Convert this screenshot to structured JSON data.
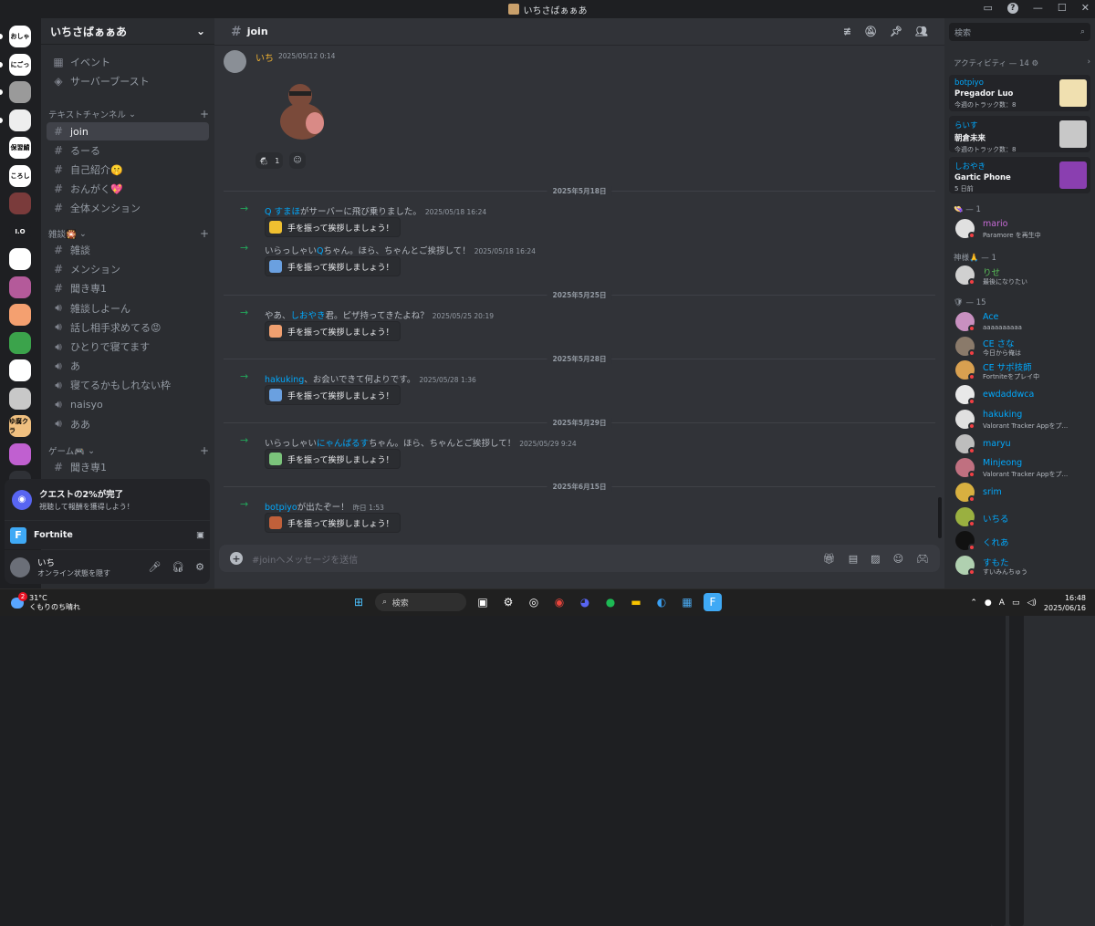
{
  "window": {
    "title": "いちさばぁぁあ",
    "controls": [
      "inbox-icon",
      "help-icon",
      "minimize",
      "maximize",
      "close"
    ]
  },
  "rail": {
    "servers": [
      "おしゃ",
      "にごっ",
      "",
      "",
      "保習鯖",
      "ころし",
      "",
      "I.O",
      "",
      "",
      "",
      "",
      "",
      "",
      "ゆ腐クラ",
      "",
      "",
      "",
      ""
    ]
  },
  "sidebar": {
    "guild_name": "いちさばぁぁあ",
    "top_items": [
      "イベント",
      "サーバーブースト"
    ],
    "categories": {
      "text": "テキストチャンネル",
      "chat": "雑談🎇",
      "game": "ゲーム🎮"
    },
    "channels_text": [
      {
        "name": "join",
        "active": true
      },
      {
        "name": "るーる"
      },
      {
        "name": "自己紹介🤫"
      },
      {
        "name": "おんがく💖"
      },
      {
        "name": "全体メンション"
      }
    ],
    "channels_chat": [
      {
        "name": "雑談",
        "type": "text"
      },
      {
        "name": "メンション",
        "type": "text"
      },
      {
        "name": "聞き専1",
        "type": "text"
      },
      {
        "name": "雑談しよーん",
        "type": "voice"
      },
      {
        "name": "話し相手求めてる😡",
        "type": "voice"
      },
      {
        "name": "ひとりで寝てます",
        "type": "voice",
        "badges": [
          "00",
          "01"
        ]
      },
      {
        "name": "あ",
        "type": "voice"
      },
      {
        "name": "寝てるかもしれない枠",
        "type": "voice"
      },
      {
        "name": "naisyo",
        "type": "voice"
      },
      {
        "name": "ああ",
        "type": "voice"
      }
    ],
    "channels_game": [
      {
        "name": "聞き専1",
        "type": "text"
      }
    ],
    "quest": {
      "title": "クエストの2%が完了",
      "subtitle": "視聴して報酬を獲得しよう！"
    },
    "activity": {
      "game": "Fortnite"
    },
    "user": {
      "name": "いち",
      "status": "オンライン状態を隠す"
    }
  },
  "channel": {
    "name": "join",
    "composer_placeholder": "#joinへメッセージを送信"
  },
  "messages": {
    "first": {
      "author": "いち",
      "timestamp": "2025/05/12 0:14",
      "reaction_count": "1"
    },
    "dividers": [
      "2025年5月18日",
      "2025年5月25日",
      "2025年5月28日",
      "2025年5月29日",
      "2025年6月15日"
    ],
    "joins": [
      {
        "pre": "",
        "name": "Q すまほ",
        "post": "がサーバーに飛び乗りました。",
        "timestamp": "2025/05/18 16:24",
        "wave": "手を振って挨拶しましょう！"
      },
      {
        "pre": "いらっしゃい",
        "name": "Q",
        "post": "ちゃん。ほら、ちゃんとご挨拶して！",
        "timestamp": "2025/05/18 16:24",
        "wave": "手を振って挨拶しましょう！"
      },
      {
        "pre": "やあ、",
        "name": "しおやき",
        "post": "君。ピザ持ってきたよね？",
        "timestamp": "2025/05/25 20:19",
        "wave": "手を振って挨拶しましょう！"
      },
      {
        "pre": "",
        "name": "hakuking",
        "post": "、お会いできて何よりです。",
        "timestamp": "2025/05/28 1:36",
        "wave": "手を振って挨拶しましょう！"
      },
      {
        "pre": "いらっしゃい",
        "name": "にゃんぱるす",
        "post": "ちゃん。ほら、ちゃんとご挨拶して！",
        "timestamp": "2025/05/29 9:24",
        "wave": "手を振って挨拶しましょう！"
      },
      {
        "pre": "",
        "name": "botpiyo",
        "post": "が出たぞー！",
        "timestamp": "昨日 1:53",
        "wave": "手を振って挨拶しましょう！"
      }
    ]
  },
  "right": {
    "search_placeholder": "検索",
    "activity_header": "アクティビティ — 14 ⚙",
    "cards": [
      {
        "user": "botpiyo",
        "game": "Pregador Luo",
        "sub": "今週のトラック数：8"
      },
      {
        "user": "らいす",
        "game": "朝倉未来",
        "sub": "今週のトラック数：8"
      },
      {
        "user": "しおやき",
        "game": "Gartic Phone",
        "sub": "5 日前"
      }
    ],
    "groups": [
      {
        "label": "👒 — 1",
        "members": [
          {
            "name": "mario",
            "status": "Paramore を再生中",
            "color": "#c76bd6"
          }
        ]
      },
      {
        "label": "神様🙏 — 1",
        "members": [
          {
            "name": "りせ",
            "status": "最後になりたい",
            "color": "#5ac05a"
          }
        ]
      },
      {
        "label": "🛡 — 15",
        "members": [
          {
            "name": "Ace",
            "status": "aaaaaaaaaa",
            "color": "#00a8fc"
          },
          {
            "name": "CE さな",
            "status": "今日から俺は",
            "color": "#00a8fc"
          },
          {
            "name": "CE サポ技師",
            "status": "Fortniteをプレイ中",
            "color": "#00a8fc"
          },
          {
            "name": "ewdaddwca",
            "status": "",
            "color": "#00a8fc"
          },
          {
            "name": "hakuking",
            "status": "Valorant Tracker Appをプ...",
            "color": "#00a8fc"
          },
          {
            "name": "maryu",
            "status": "",
            "color": "#00a8fc"
          },
          {
            "name": "Minjeong",
            "status": "Valorant Tracker Appをプ...",
            "color": "#00a8fc"
          },
          {
            "name": "srim",
            "status": "",
            "color": "#00a8fc"
          },
          {
            "name": "いちる",
            "status": "",
            "color": "#00a8fc"
          },
          {
            "name": "くれあ",
            "status": "",
            "color": "#00a8fc"
          },
          {
            "name": "すもた",
            "status": "すいみんちゅう",
            "color": "#00a8fc"
          }
        ]
      }
    ]
  },
  "taskbar": {
    "weather_temp": "31°C",
    "weather_desc": "くもりのち晴れ",
    "weather_badge": "2",
    "search": "検索",
    "time": "16:48",
    "date": "2025/06/16",
    "lang": "A"
  }
}
